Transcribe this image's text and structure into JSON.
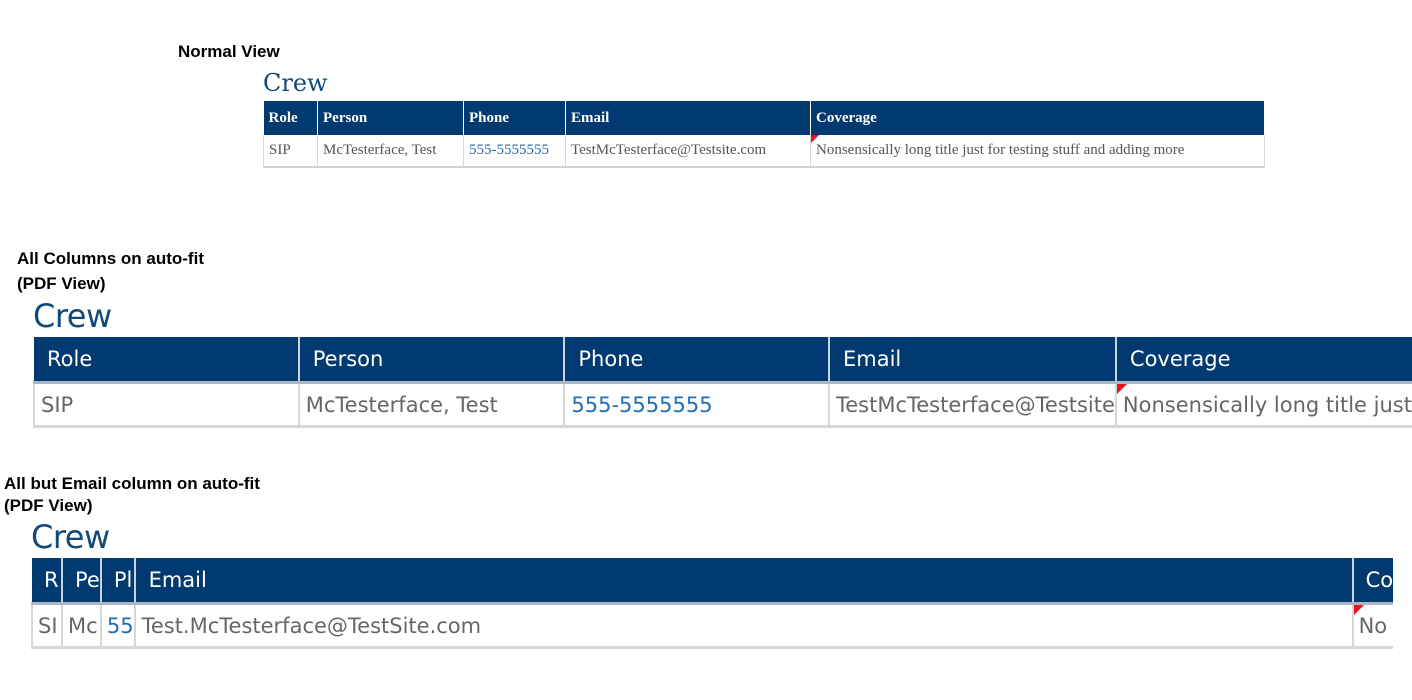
{
  "sections": [
    {
      "caption_lines": [
        "Normal View"
      ],
      "title": "Crew",
      "headers": [
        "Role",
        "Person",
        "Phone",
        "Email",
        "Coverage"
      ],
      "row": {
        "role": "SIP",
        "person": "McTesterface, Test",
        "phone": "555-5555555",
        "email": "TestMcTesterface@Testsite.com",
        "coverage": "Nonsensically long title just for testing stuff and adding more"
      }
    },
    {
      "caption_lines": [
        "All Columns on auto-fit",
        "(PDF View)"
      ],
      "title": "Crew",
      "headers": [
        "Role",
        "Person",
        "Phone",
        "Email",
        "Coverage"
      ],
      "row": {
        "role": "SIP",
        "person": "McTesterface, Test",
        "phone": "555-5555555",
        "email": "TestMcTesterface@Testsite",
        "coverage": "Nonsensically long title just"
      }
    },
    {
      "caption_lines": [
        "All but Email column on auto-fit",
        "(PDF View)"
      ],
      "title": "Crew",
      "headers": [
        "R",
        "Pe",
        "Pl",
        "Email",
        "Co"
      ],
      "row": {
        "role": "SI",
        "person": "Mc",
        "phone": "55",
        "email": "Test.McTesterface@TestSite.com",
        "coverage": "No"
      }
    }
  ],
  "colors": {
    "header_bg": "#003a70",
    "title_text": "#13497a",
    "phone_link": "#1f6fb6",
    "comment_flag": "#e8131b"
  }
}
